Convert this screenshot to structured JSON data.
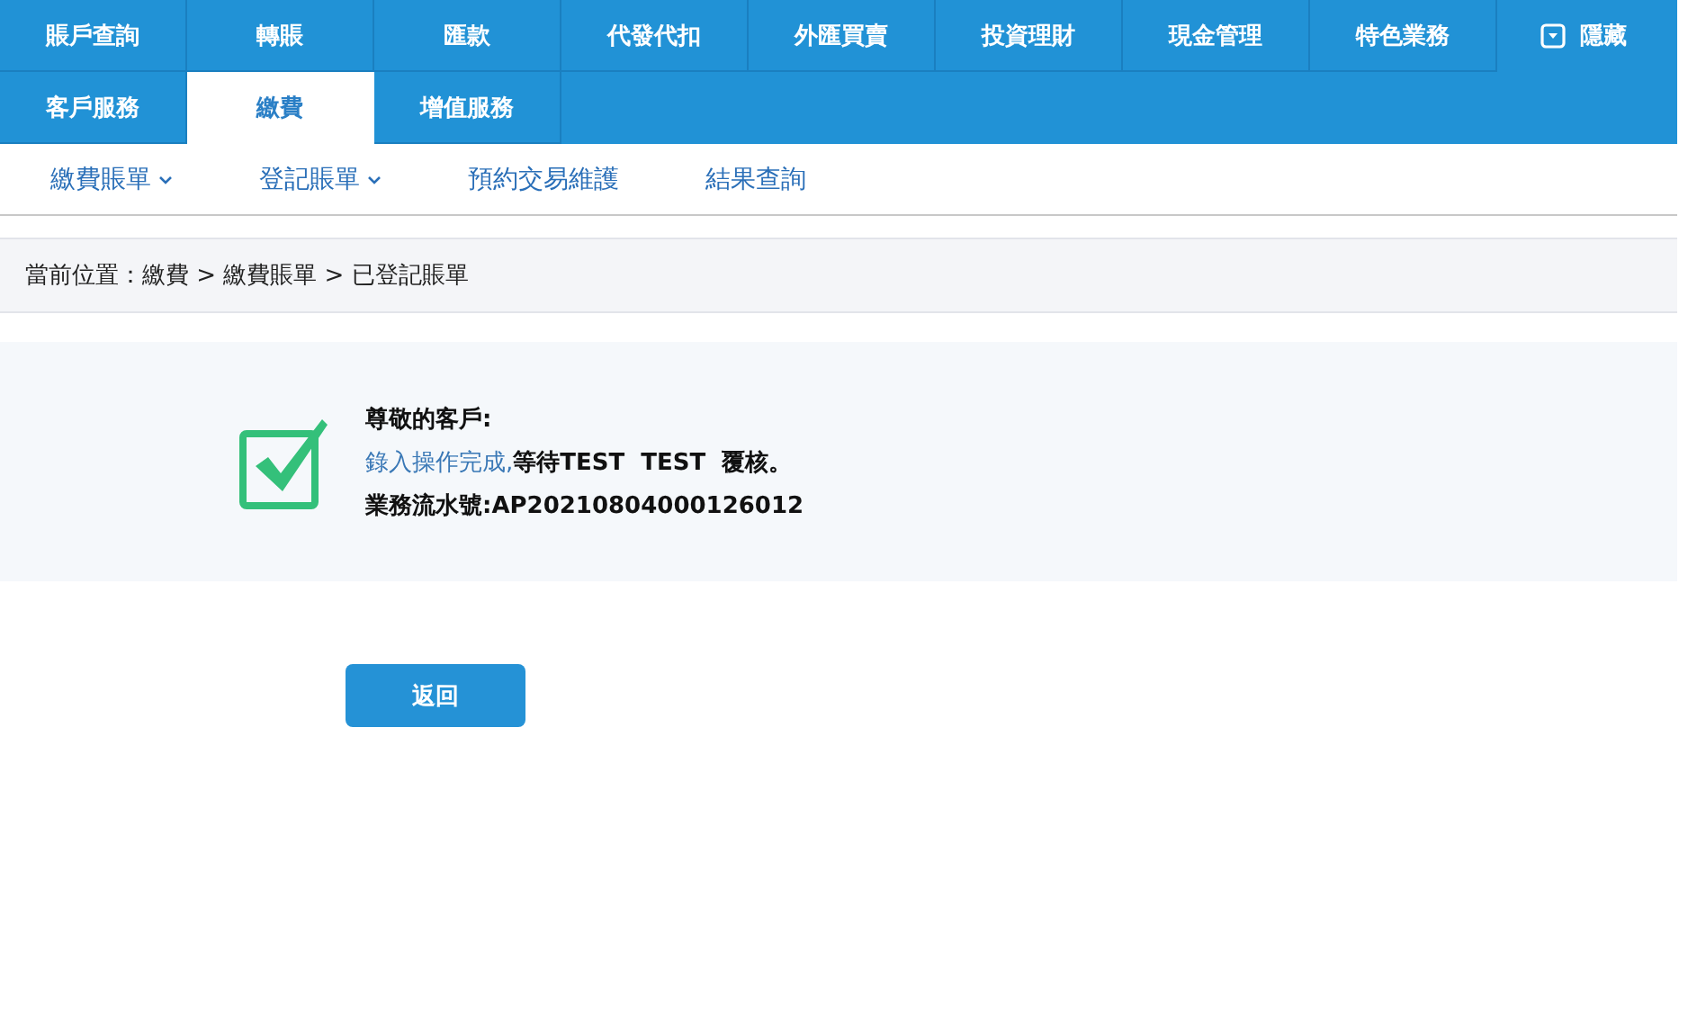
{
  "main_nav": {
    "rows": [
      [
        {
          "label": "賬戶查詢",
          "selected": false
        },
        {
          "label": "轉賬",
          "selected": false
        },
        {
          "label": "匯款",
          "selected": false
        },
        {
          "label": "代發代扣",
          "selected": false
        },
        {
          "label": "外匯買賣",
          "selected": false
        },
        {
          "label": "投資理財",
          "selected": false
        },
        {
          "label": "現金管理",
          "selected": false
        },
        {
          "label": "特色業務",
          "selected": false
        }
      ],
      [
        {
          "label": "客戶服務",
          "selected": false
        },
        {
          "label": "繳費",
          "selected": true
        },
        {
          "label": "增值服務",
          "selected": false
        }
      ]
    ],
    "hide_button": "隱藏"
  },
  "sub_nav": [
    {
      "label": "繳費賬單",
      "dropdown": true
    },
    {
      "label": "登記賬單",
      "dropdown": true
    },
    {
      "label": "預約交易維護",
      "dropdown": false
    },
    {
      "label": "結果查詢",
      "dropdown": false
    }
  ],
  "breadcrumb": "當前位置：繳費 > 繳費賬單 > 已登記賬單",
  "message": {
    "greeting": "尊敬的客戶:",
    "status": "錄入操作完成,",
    "status_rest": "等待TEST  TEST  覆核。",
    "serial": "業務流水號:AP20210804000126012"
  },
  "back_button": "返回"
}
